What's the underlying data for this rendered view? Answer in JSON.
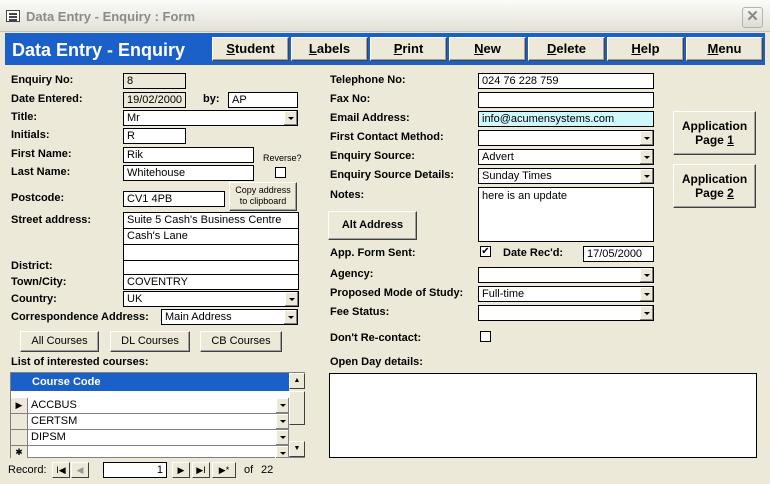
{
  "window": {
    "title": "Data Entry - Enquiry : Form",
    "close_glyph": "✕"
  },
  "header": {
    "title": "Data Entry - Enquiry"
  },
  "nav": {
    "student": {
      "u": "S",
      "rest": "tudent"
    },
    "labels": {
      "u": "L",
      "rest": "abels"
    },
    "print": {
      "u": "P",
      "rest": "rint"
    },
    "new": {
      "u": "N",
      "rest": "ew"
    },
    "delete": {
      "u": "D",
      "rest": "elete"
    },
    "help": {
      "u": "H",
      "rest": "elp"
    },
    "menu": {
      "u": "M",
      "rest": "enu"
    }
  },
  "left": {
    "enquiry_no": {
      "label": "Enquiry No:",
      "value": "8"
    },
    "date_entered": {
      "label": "Date Entered:",
      "value": "19/02/2000",
      "by_label": "by:",
      "by_value": "AP"
    },
    "title": {
      "label": "Title:",
      "value": "Mr"
    },
    "initials": {
      "label": "Initials:",
      "value": "R"
    },
    "first_name": {
      "label": "First Name:",
      "value": "Rik"
    },
    "last_name": {
      "label": "Last Name:",
      "value": "Whitehouse"
    },
    "reverse_label": "Reverse?",
    "postcode": {
      "label": "Postcode:",
      "value": "CV1 4PB"
    },
    "copy_address": {
      "line1": "Copy address",
      "line2": "to clipboard"
    },
    "street_address": {
      "label": "Street address:",
      "lines": [
        "Suite 5 Cash's Business Centre",
        "Cash's Lane",
        "",
        ""
      ]
    },
    "district": {
      "label": "District:",
      "value": ""
    },
    "town": {
      "label": "Town/City:",
      "value": "COVENTRY"
    },
    "country": {
      "label": "Country:",
      "value": "UK"
    },
    "correspondence": {
      "label": "Correspondence Address:",
      "value": "Main Address"
    },
    "course_buttons": [
      "All Courses",
      "DL Courses",
      "CB Courses"
    ],
    "courses_label": "List of interested courses:"
  },
  "subform": {
    "header": "Course Code",
    "rows": [
      "ACCBUS",
      "CERTSM",
      "DIPSM",
      ""
    ]
  },
  "right": {
    "telephone": {
      "label": "Telephone No:",
      "value": "024 76 228 759"
    },
    "fax": {
      "label": "Fax No:",
      "value": ""
    },
    "email": {
      "label": "Email Address:",
      "value": "info@acumensystems.com"
    },
    "first_contact": {
      "label": "First Contact Method:",
      "value": ""
    },
    "enquiry_source": {
      "label": "Enquiry Source:",
      "value": "Advert"
    },
    "source_details": {
      "label": "Enquiry Source Details:",
      "value": "Sunday Times"
    },
    "notes": {
      "label": "Notes:",
      "value": "here is an update"
    },
    "alt_address": "Alt Address",
    "app_form_sent": {
      "label": "App. Form Sent:",
      "checked": true,
      "check_glyph": "✔"
    },
    "date_recd": {
      "label": "Date Rec'd:",
      "value": "17/05/2000"
    },
    "agency": {
      "label": "Agency:",
      "value": ""
    },
    "mode_of_study": {
      "label": "Proposed Mode of Study:",
      "value": "Full-time"
    },
    "fee_status": {
      "label": "Fee Status:",
      "value": ""
    },
    "dont_recontact": {
      "label": "Don't Re-contact:"
    },
    "open_day": {
      "label": "Open Day details:",
      "value": ""
    }
  },
  "app_buttons": [
    {
      "line1": "Application",
      "line2_prefix": "Page ",
      "line2_num": "1"
    },
    {
      "line1": "Application",
      "line2_prefix": "Page ",
      "line2_num": "2"
    }
  ],
  "record_nav": {
    "label": "Record:",
    "current": "1",
    "of_label": "of",
    "total": "22"
  },
  "glyphs": {
    "first": "I◀",
    "prev": "◀",
    "next": "▶",
    "last": "▶I",
    "new": "▶*",
    "row_pointer": "▶",
    "new_row": "✱",
    "scroll_up": "▲",
    "scroll_down": "▼"
  }
}
